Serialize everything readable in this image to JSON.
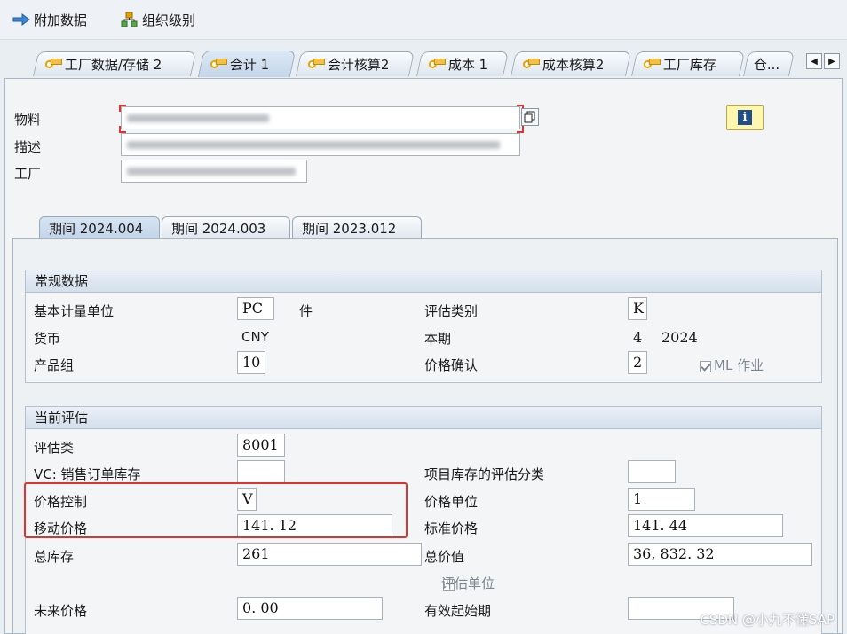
{
  "toolbar": {
    "additional_data": "附加数据",
    "org_levels": "组织级别"
  },
  "tabs": [
    {
      "label": "工厂数据/存储 2"
    },
    {
      "label": "会计 1"
    },
    {
      "label": "会计核算2"
    },
    {
      "label": "成本 1"
    },
    {
      "label": "成本核算2"
    },
    {
      "label": "工厂库存"
    },
    {
      "label": "仓..."
    }
  ],
  "header": {
    "material_label": "物料",
    "description_label": "描述",
    "plant_label": "工厂"
  },
  "period_tabs": [
    {
      "label": "期间 2024.004"
    },
    {
      "label": "期间 2024.003"
    },
    {
      "label": "期间 2023.012"
    }
  ],
  "general": {
    "title": "常规数据",
    "base_uom_label": "基本计量单位",
    "base_uom_value": "PC",
    "base_uom_text": "件",
    "currency_label": "货币",
    "currency_value": "CNY",
    "division_label": "产品组",
    "division_value": "10",
    "valuation_category_label": "评估类别",
    "valuation_category_value": "K",
    "current_period_label": "本期",
    "current_period_month": "4",
    "current_period_year": "2024",
    "price_determination_label": "价格确认",
    "price_determination_value": "2",
    "ml_act_label": "ML 作业"
  },
  "valuation": {
    "title": "当前评估",
    "valuation_class_label": "评估类",
    "valuation_class_value": "8001",
    "vc_sales_order_label": "VC: 销售订单库存",
    "vc_sales_order_value": "",
    "project_stock_label": "项目库存的评估分类",
    "project_stock_value": "",
    "price_control_label": "价格控制",
    "price_control_value": "V",
    "price_unit_label": "价格单位",
    "price_unit_value": "1",
    "moving_price_label": "移动价格",
    "moving_price_value": "141. 12",
    "standard_price_label": "标准价格",
    "standard_price_value": "141. 44",
    "total_stock_label": "总库存",
    "total_stock_value": "261",
    "total_value_label": "总价值",
    "total_value_value": "36, 832. 32",
    "valuated_unit_label": "评估单位",
    "future_price_label": "未来价格",
    "future_price_value": "0. 00",
    "valid_from_label": "有效起始期",
    "valid_from_value": ""
  },
  "watermark": "CSDN @小九不懂SAP",
  "colors": {
    "highlight_border": "#e0322f",
    "tab_active": "#c4d6ea",
    "group_header": "#d3dfec"
  }
}
